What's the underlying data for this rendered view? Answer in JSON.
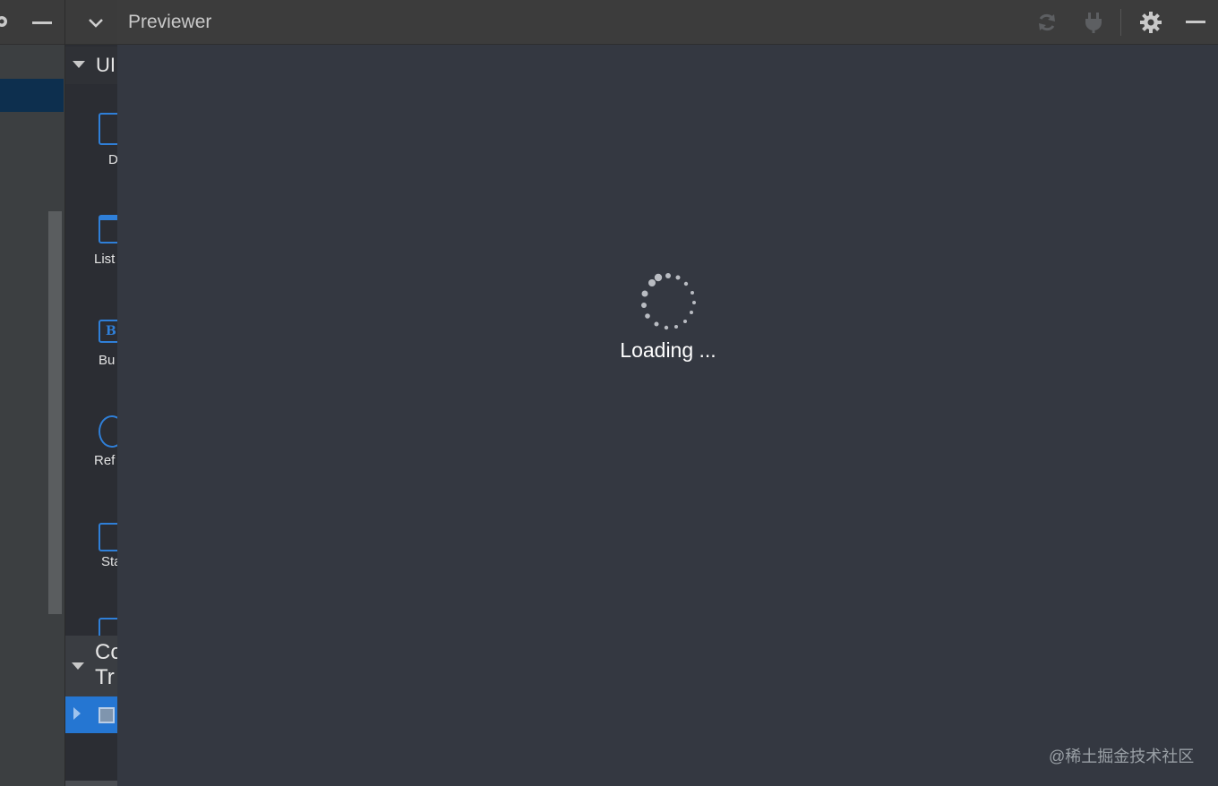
{
  "previewer": {
    "title": "Previewer",
    "loading_text": "Loading ...",
    "icons": [
      "refresh-icon",
      "plug-icon",
      "settings-icon",
      "hide-icon"
    ]
  },
  "component_panel": {
    "section_title": "UI",
    "items": [
      {
        "label": "D",
        "icon": "div-icon"
      },
      {
        "label": "List",
        "icon": "list-icon"
      },
      {
        "label": "Bu",
        "icon": "button-icon"
      },
      {
        "label": "Ref",
        "icon": "refresh-component-icon"
      },
      {
        "label": "Sta",
        "icon": "stack-icon"
      }
    ],
    "tree_title_line1": "Co",
    "tree_title_line2": "Tr"
  },
  "watermark": "@稀土掘金技术社区",
  "colors": {
    "accent": "#2f7fd8",
    "tree_selection": "#2576d2",
    "preview_bg": "#343841"
  }
}
